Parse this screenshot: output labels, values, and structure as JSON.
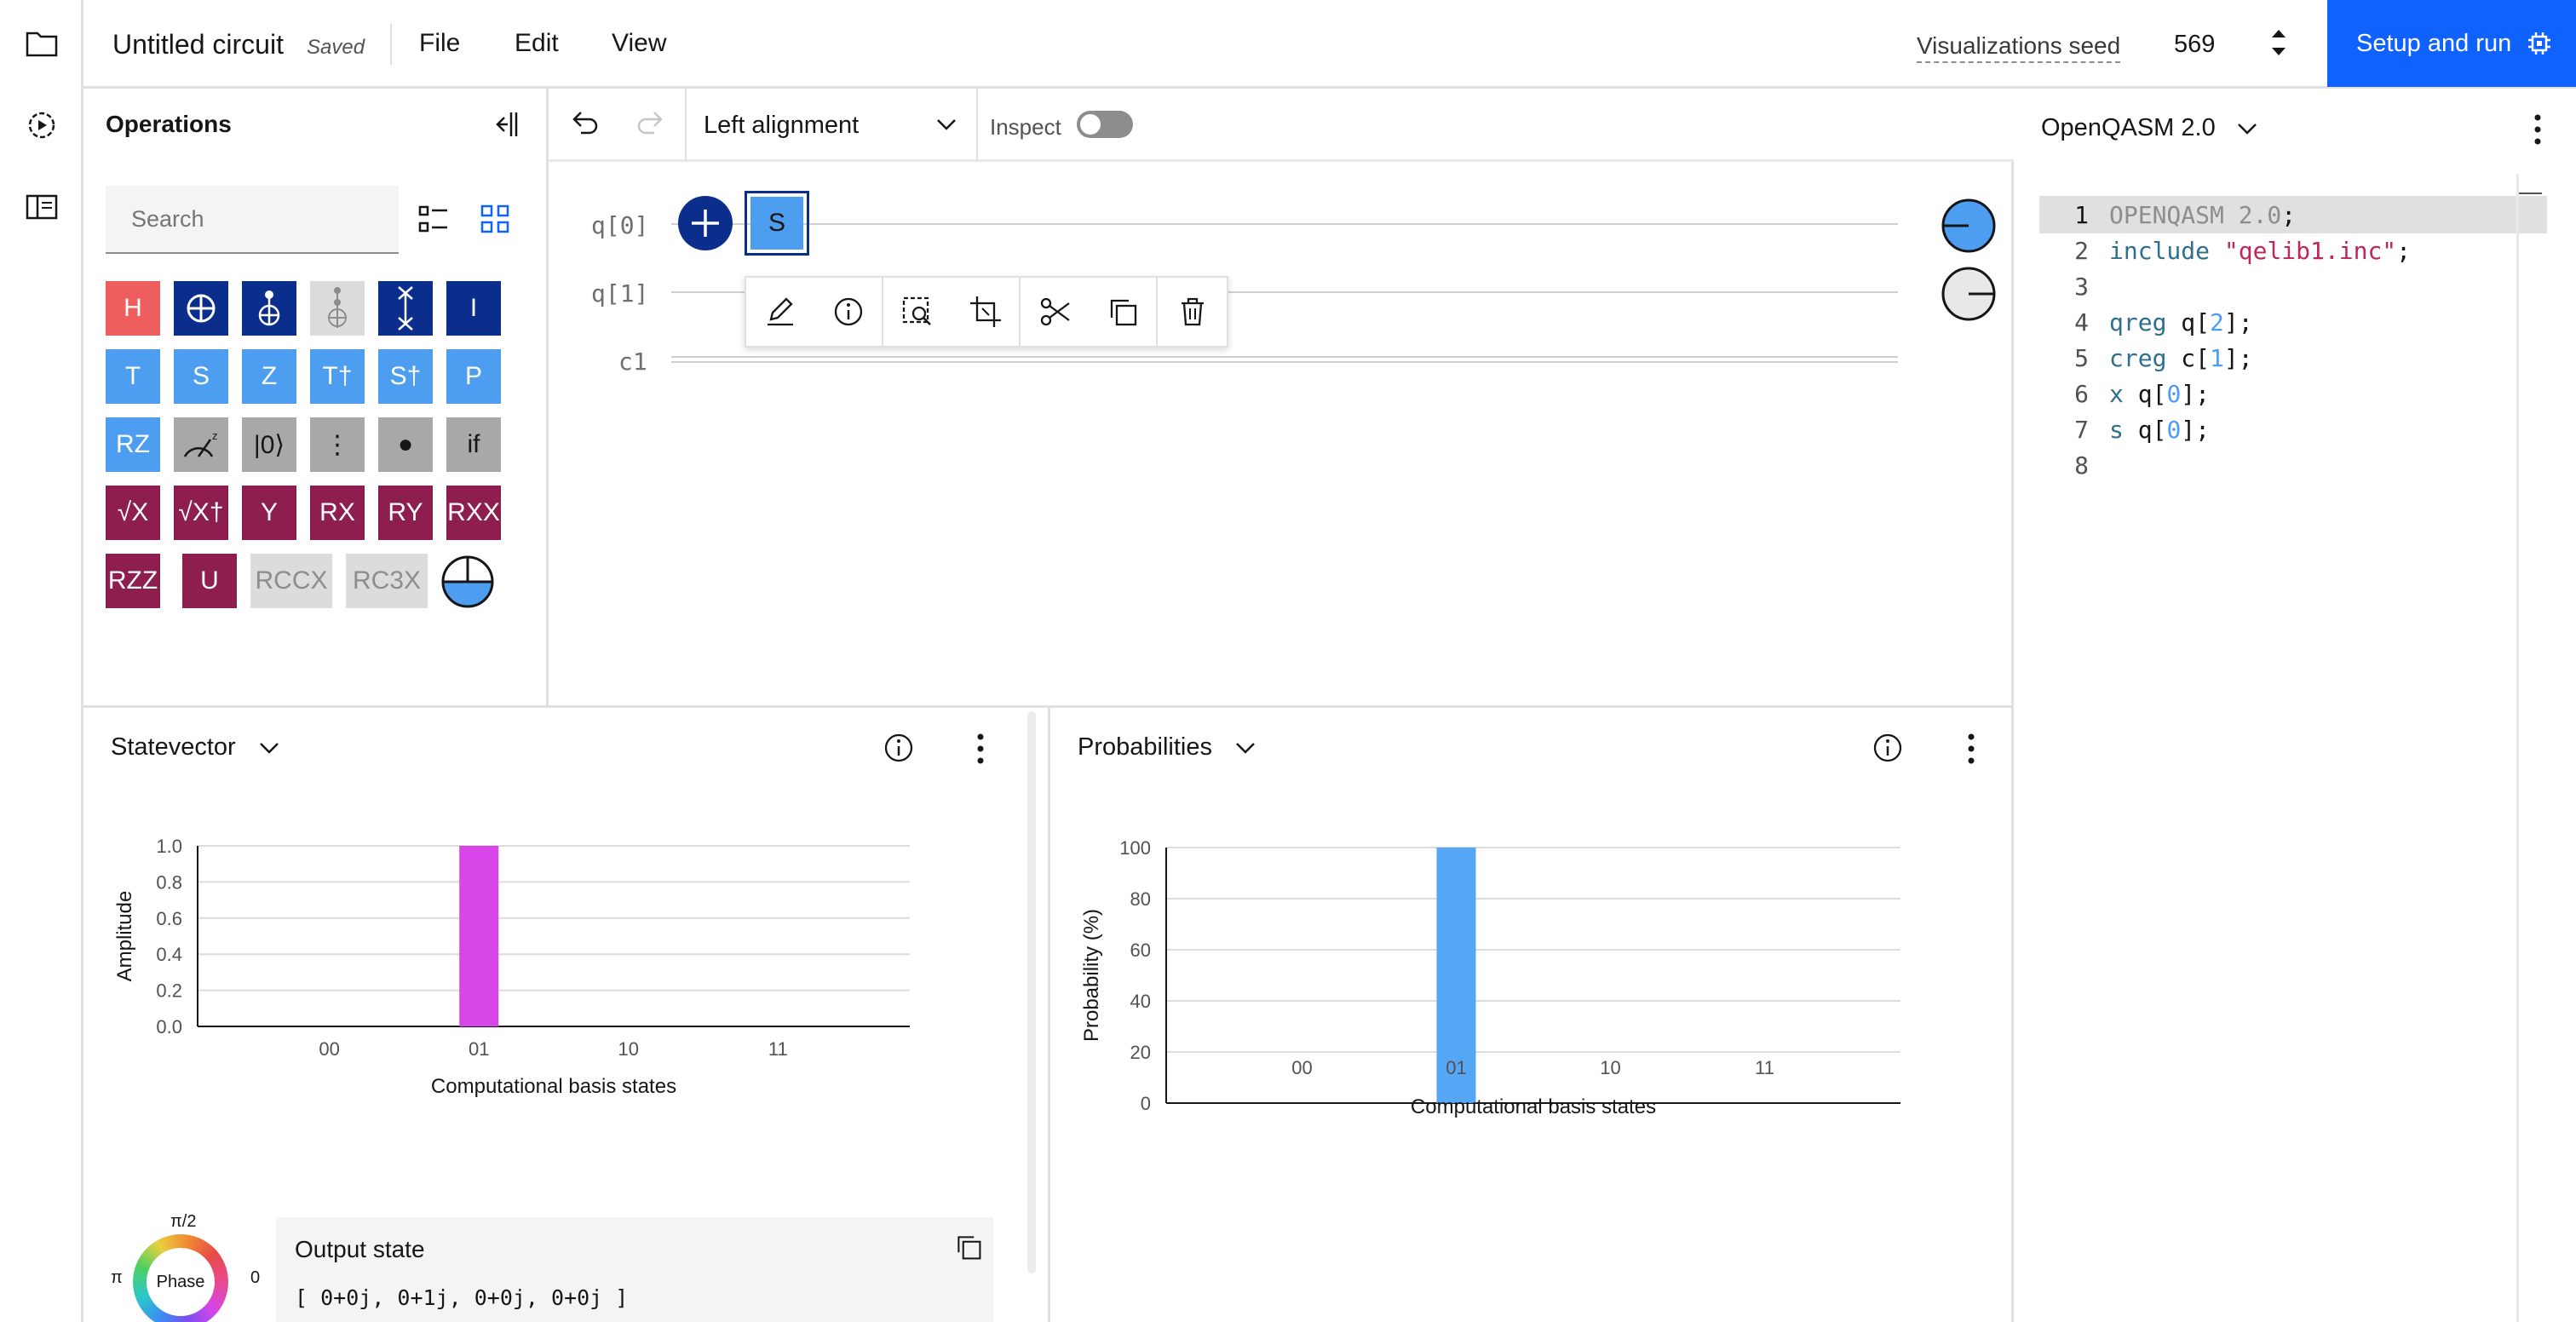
{
  "header": {
    "title": "Untitled circuit",
    "saved": "Saved",
    "menu": [
      "File",
      "Edit",
      "View"
    ],
    "seed_label": "Visualizations seed",
    "seed_value": "569",
    "run_label": "Setup and run"
  },
  "operations": {
    "title": "Operations",
    "search_placeholder": "Search",
    "rows": [
      [
        {
          "label": "H",
          "style": "red"
        },
        {
          "label": "⊕",
          "style": "navy"
        },
        {
          "label": "cnot",
          "style": "navy"
        },
        {
          "label": "toffoli",
          "style": "gray"
        },
        {
          "label": "swap",
          "style": "navy"
        },
        {
          "label": "I",
          "style": "navy"
        }
      ],
      [
        {
          "label": "T",
          "style": "blue"
        },
        {
          "label": "S",
          "style": "blue"
        },
        {
          "label": "Z",
          "style": "blue"
        },
        {
          "label": "T†",
          "style": "blue"
        },
        {
          "label": "S†",
          "style": "blue"
        },
        {
          "label": "P",
          "style": "blue"
        }
      ],
      [
        {
          "label": "RZ",
          "style": "blue"
        },
        {
          "label": "measure",
          "style": "gray"
        },
        {
          "label": "|0⟩",
          "style": "gray"
        },
        {
          "label": "⋮",
          "style": "gray"
        },
        {
          "label": "●",
          "style": "gray"
        },
        {
          "label": "if",
          "style": "gray"
        }
      ],
      [
        {
          "label": "√X",
          "style": "maroon"
        },
        {
          "label": "√X†",
          "style": "maroon"
        },
        {
          "label": "Y",
          "style": "maroon"
        },
        {
          "label": "RX",
          "style": "maroon"
        },
        {
          "label": "RY",
          "style": "maroon"
        },
        {
          "label": "RXX",
          "style": "maroon"
        }
      ],
      [
        {
          "label": "RZZ",
          "style": "maroon"
        },
        {
          "label": "U",
          "style": "maroon"
        },
        {
          "label": "RCCX",
          "style": "light"
        },
        {
          "label": "RC3X",
          "style": "light"
        }
      ]
    ]
  },
  "circuit": {
    "alignment": "Left alignment",
    "inspect_label": "Inspect",
    "wires": [
      "q[0]",
      "q[1]",
      "c1"
    ],
    "placed_gate": "S",
    "colors": {
      "accent": "#0f62fe",
      "navy": "#0b2d8c",
      "gate_blue": "#4d9ef0"
    }
  },
  "code": {
    "language": "OpenQASM 2.0",
    "lines": [
      {
        "n": "1",
        "text": "OPENQASM 2.0;"
      },
      {
        "n": "2",
        "text": "include \"qelib1.inc\";"
      },
      {
        "n": "3",
        "text": ""
      },
      {
        "n": "4",
        "text": "qreg q[2];"
      },
      {
        "n": "5",
        "text": "creg c[1];"
      },
      {
        "n": "6",
        "text": "x q[0];"
      },
      {
        "n": "7",
        "text": "s q[0];"
      },
      {
        "n": "8",
        "text": ""
      }
    ]
  },
  "statevector": {
    "title": "Statevector",
    "output_title": "Output state",
    "output_value": "[ 0+0j, 0+1j, 0+0j, 0+0j ]",
    "phase_label": "Phase",
    "phase_top": "π/2",
    "phase_left": "π",
    "phase_right": "0"
  },
  "probabilities": {
    "title": "Probabilities"
  },
  "chart_data": [
    {
      "type": "bar",
      "title": "Statevector",
      "categories": [
        "00",
        "01",
        "10",
        "11"
      ],
      "values": [
        0,
        1.0,
        0,
        0
      ],
      "xlabel": "Computational basis states",
      "ylabel": "Amplitude",
      "ylim": [
        0,
        1.0
      ],
      "yticks": [
        "0.0",
        "0.2",
        "0.4",
        "0.6",
        "0.8",
        "1.0"
      ],
      "grid": true,
      "color": "#d646e8"
    },
    {
      "type": "bar",
      "title": "Probabilities",
      "categories": [
        "00",
        "01",
        "10",
        "11"
      ],
      "values": [
        0,
        100,
        0,
        0
      ],
      "xlabel": "Computational basis states",
      "ylabel": "Probability (%)",
      "ylim": [
        0,
        100
      ],
      "yticks": [
        "0",
        "20",
        "40",
        "60",
        "80",
        "100"
      ],
      "grid": true,
      "color": "#55a6f5"
    }
  ]
}
